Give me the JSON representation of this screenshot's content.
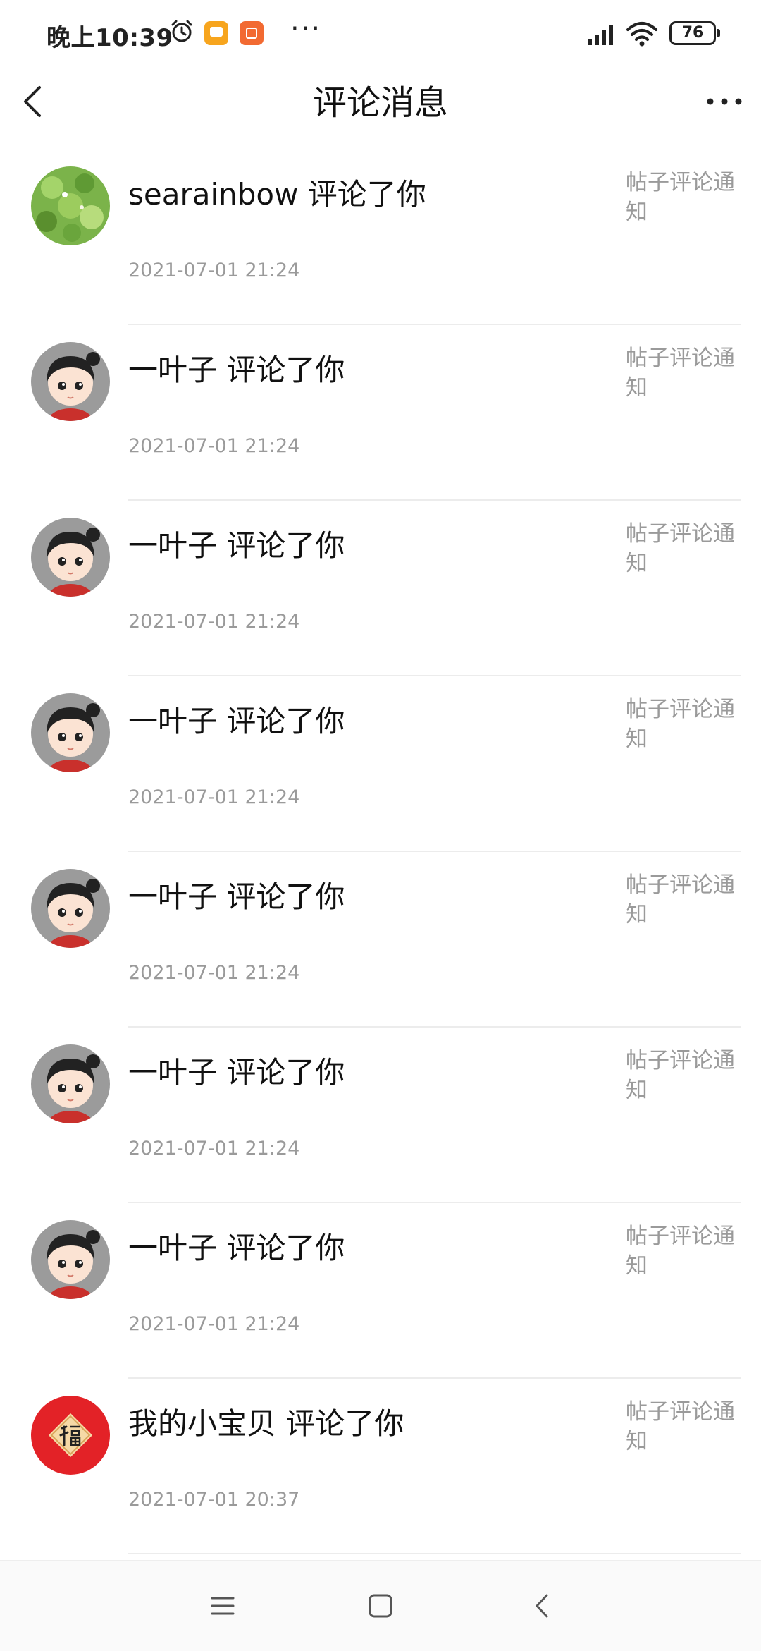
{
  "status_bar": {
    "time": "晚上10:39",
    "more": "···",
    "battery": "76",
    "icons": [
      "alarm-icon",
      "app-notification-icon",
      "shop-app-icon",
      "signal-icon",
      "wifi-icon",
      "battery-icon"
    ]
  },
  "header": {
    "title": "评论消息",
    "back_icon": "chevron-left-icon",
    "more_icon": "more-horizontal-icon"
  },
  "messages": [
    {
      "title": "searainbow 评论了你",
      "time": "2021-07-01 21:24",
      "tag": "帖子评论通知",
      "avatar": "clover-avatar"
    },
    {
      "title": "一叶子 评论了你",
      "time": "2021-07-01 21:24",
      "tag": "帖子评论通知",
      "avatar": "cartoon-girl-avatar"
    },
    {
      "title": "一叶子 评论了你",
      "time": "2021-07-01 21:24",
      "tag": "帖子评论通知",
      "avatar": "cartoon-girl-avatar"
    },
    {
      "title": "一叶子 评论了你",
      "time": "2021-07-01 21:24",
      "tag": "帖子评论通知",
      "avatar": "cartoon-girl-avatar"
    },
    {
      "title": "一叶子 评论了你",
      "time": "2021-07-01 21:24",
      "tag": "帖子评论通知",
      "avatar": "cartoon-girl-avatar"
    },
    {
      "title": "一叶子 评论了你",
      "time": "2021-07-01 21:24",
      "tag": "帖子评论通知",
      "avatar": "cartoon-girl-avatar"
    },
    {
      "title": "一叶子 评论了你",
      "time": "2021-07-01 21:24",
      "tag": "帖子评论通知",
      "avatar": "cartoon-girl-avatar"
    },
    {
      "title": "我的小宝贝 评论了你",
      "time": "2021-07-01 20:37",
      "tag": "帖子评论通知",
      "avatar": "fu-character-avatar"
    }
  ],
  "nav_bar": {
    "icons": [
      "menu-icon",
      "home-square-icon",
      "back-triangle-icon"
    ]
  },
  "colors": {
    "background": "#ffffff",
    "primary_text": "#111111",
    "secondary_text": "#9a9a9a",
    "divider": "#ececec",
    "fu_red": "#e32227"
  }
}
